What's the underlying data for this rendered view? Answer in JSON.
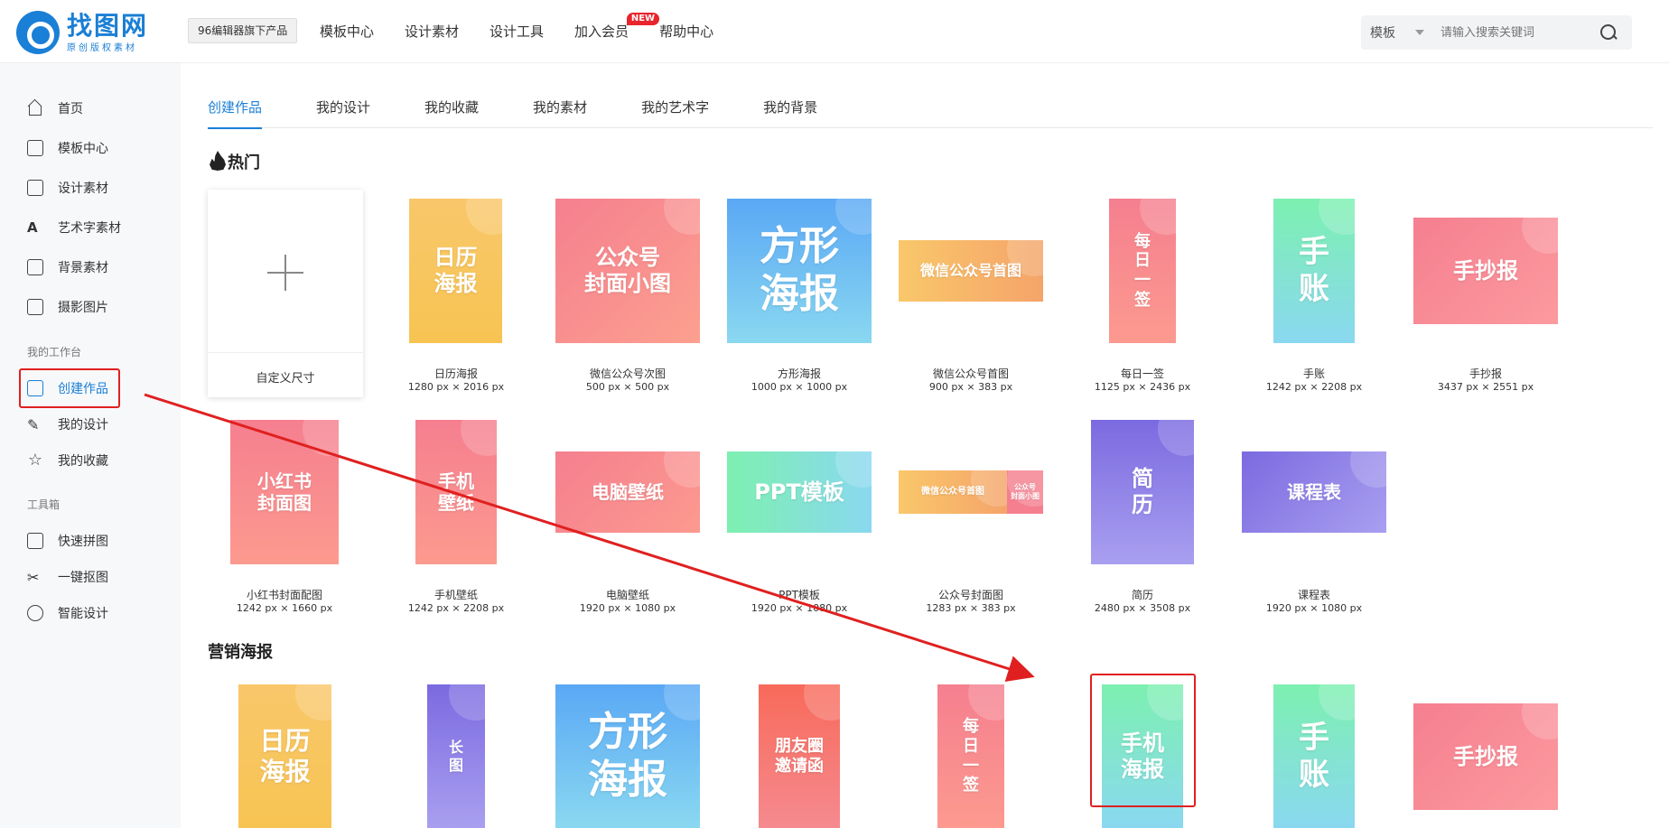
{
  "header": {
    "logo_title": "找图网",
    "logo_sub": "原创版权素材",
    "product_badge": "96编辑器旗下产品",
    "nav": [
      {
        "label": "模板中心"
      },
      {
        "label": "设计素材"
      },
      {
        "label": "设计工具"
      },
      {
        "label": "加入会员",
        "tag": "NEW"
      },
      {
        "label": "帮助中心"
      }
    ],
    "search_type": "模板",
    "search_placeholder": "请输入搜索关键词"
  },
  "sidebar": {
    "items": [
      {
        "label": "首页"
      },
      {
        "label": "模板中心"
      },
      {
        "label": "设计素材"
      },
      {
        "label": "艺术字素材"
      },
      {
        "label": "背景素材"
      },
      {
        "label": "摄影图片"
      }
    ],
    "group_workspace": "我的工作台",
    "workspace_items": [
      {
        "label": "创建作品"
      },
      {
        "label": "我的设计"
      },
      {
        "label": "我的收藏"
      }
    ],
    "group_tools": "工具箱",
    "tool_items": [
      {
        "label": "快速拼图"
      },
      {
        "label": "一键抠图"
      },
      {
        "label": "智能设计"
      }
    ]
  },
  "tabs": [
    "创建作品",
    "我的设计",
    "我的收藏",
    "我的素材",
    "我的艺术字",
    "我的背景"
  ],
  "sections": {
    "hot": "热门",
    "marketing": "营销海报"
  },
  "custom_size": "自定义尺寸",
  "hot_row1": [
    {
      "text": "日历\n海报",
      "title": "日历海报",
      "size": "1280 px × 2016 px"
    },
    {
      "text": "公众号\n封面小图",
      "title": "微信公众号次图",
      "size": "500 px × 500 px"
    },
    {
      "text": "方形\n海报",
      "title": "方形海报",
      "size": "1000 px × 1000 px"
    },
    {
      "text": "微信公众号首图",
      "title": "微信公众号首图",
      "size": "900 px × 383 px"
    },
    {
      "text": "每\n日\n一\n签",
      "title": "每日一签",
      "size": "1125 px × 2436 px"
    },
    {
      "text": "手\n账",
      "title": "手账",
      "size": "1242 px × 2208 px"
    },
    {
      "text": "手抄报",
      "title": "手抄报",
      "size": "3437 px × 2551 px"
    }
  ],
  "hot_row2": [
    {
      "text": "小红书\n封面图",
      "title": "小红书封面配图",
      "size": "1242 px × 1660 px"
    },
    {
      "text": "手机\n壁纸",
      "title": "手机壁纸",
      "size": "1242 px × 2208 px"
    },
    {
      "text": "电脑壁纸",
      "title": "电脑壁纸",
      "size": "1920 px × 1080 px"
    },
    {
      "text": "PPT模板",
      "title": "PPT模板",
      "size": "1920 px × 1080 px"
    },
    {
      "text": "微信公众号首图",
      "text2": "公众号\n封面小图",
      "title": "公众号封面图",
      "size": "1283 px × 383 px"
    },
    {
      "text": "简\n历",
      "title": "简历",
      "size": "2480 px × 3508 px"
    },
    {
      "text": "课程表",
      "title": "课程表",
      "size": "1920 px × 1080 px"
    }
  ],
  "marketing_row": [
    {
      "text": "日历\n海报"
    },
    {
      "text": "长\n图"
    },
    {
      "text": "方形\n海报"
    },
    {
      "text": "朋友圈\n邀请函"
    },
    {
      "text": "每\n日\n一\n签"
    },
    {
      "text": "手机\n海报"
    },
    {
      "text": "手\n账"
    },
    {
      "text": "手抄报"
    }
  ],
  "colors": {
    "accent": "#1a7fd6",
    "highlight_red": "#e02020",
    "orange": "#f9c76a",
    "pink": "#f57f8f",
    "blue": "#6ab0f5",
    "green": "#7df0b0",
    "purple": "#7b6ae0"
  }
}
